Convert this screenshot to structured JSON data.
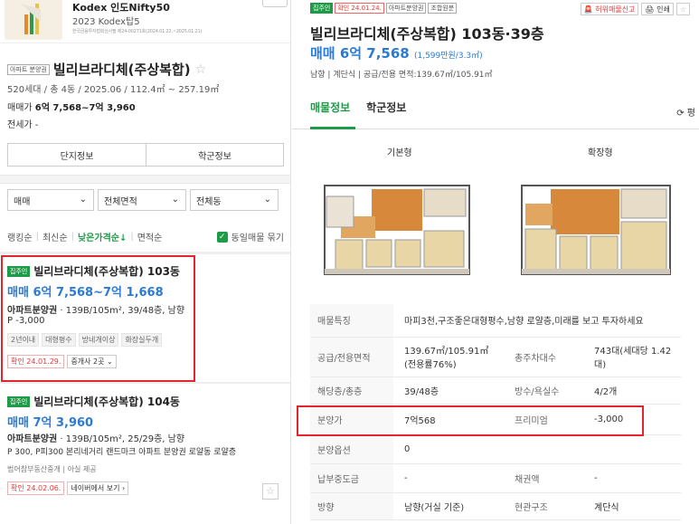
{
  "ad": {
    "title": "Kodex 인도Nifty50",
    "subtitle": "2023 Kodex탑5",
    "fine": "한국금융투자협회심사필 제24-00271호(2024.01.22.~2025.01.21)"
  },
  "complex": {
    "tag": "아파트 분양권",
    "name": "빌리브라디체(주상복합)",
    "meta": "520세대 / 총 4동 / 2025.06 / 112.4㎡ ~ 257.19㎡",
    "price_label": "매매가",
    "price_value": "6억 7,568~7억 3,960",
    "rent_label": "전세가 -",
    "btn_info": "단지정보",
    "btn_school": "학군정보"
  },
  "filters": {
    "trade": "매매",
    "area": "전체면적",
    "dong": "전체동"
  },
  "sort": {
    "items": [
      "랭킹순",
      "최신순",
      "낮은가격순↓",
      "면적순"
    ],
    "same_listing": "동일매물 묶기"
  },
  "listings": [
    {
      "tag": "집주인",
      "name": "빌리브라디체(주상복합) 103동",
      "price": "매매 6억 7,568~7억 1,668",
      "desc_bold": "아파트분양권",
      "desc": " · 139B/105m², 39/48층, 남향",
      "premium": "P -3,000",
      "tags": [
        "2년이내",
        "대형평수",
        "방네개이상",
        "화장실두개"
      ],
      "confirm": "확인 24.01.29.",
      "agents": "중개사 2곳 ⌄"
    },
    {
      "tag": "집주인",
      "name": "빌리브라디체(주상복합) 104동",
      "price": "매매 7억 3,960",
      "desc_bold": "아파트분양권",
      "desc": " · 139B/105m², 25/29층, 남향",
      "premium": "P 300, P피300 본리네거리 랜드마크 아파트 분양권 로얄동 로얄층",
      "agent": "범어참부동산중개 | 아실 제공",
      "confirm": "확인 24.02.06.",
      "naver": "네이버에서 보기 ›"
    }
  ],
  "detail": {
    "tags": [
      "집주인",
      "확인 24.01.24.",
      "아파트분양권",
      "조합원분"
    ],
    "report": "🚨 허위매물신고",
    "print": "🖨 인쇄",
    "title": "빌리브라디체(주상복합) 103동·39층",
    "price": "매매 6억 7,568",
    "price_per": "(1,599만원/3.3㎡)",
    "meta": "남향 | 계단식 | 공급/전용 면적:139.67㎡/105.91㎡",
    "tab_info": "매물정보",
    "tab_school": "학군정보",
    "refresh": "⟳ 평",
    "fp_basic": "기본형",
    "fp_ext": "확장형",
    "rows": [
      {
        "k": "매물특징",
        "v": "마피3천,구조좋은대형평수,남향 로얄층,미래를 보고 투자하세요"
      },
      {
        "k": "공급/전용면적",
        "v": "139.67㎡/105.91㎡ (전용률76%)",
        "k2": "총주차대수",
        "v2": "743대(세대당 1.42대)"
      },
      {
        "k": "해당층/총층",
        "v": "39/48층",
        "k2": "방수/욕실수",
        "v2": "4/2개"
      },
      {
        "k": "분양가",
        "v": "7억568",
        "k2": "프리미엄",
        "v2": "-3,000"
      },
      {
        "k": "분양옵션",
        "v": "0"
      },
      {
        "k": "납부중도금",
        "v": "-",
        "k2": "채권액",
        "v2": "-"
      },
      {
        "k": "방향",
        "v": "남향(거실 기준)",
        "k2": "현관구조",
        "v2": "계단식"
      }
    ]
  }
}
